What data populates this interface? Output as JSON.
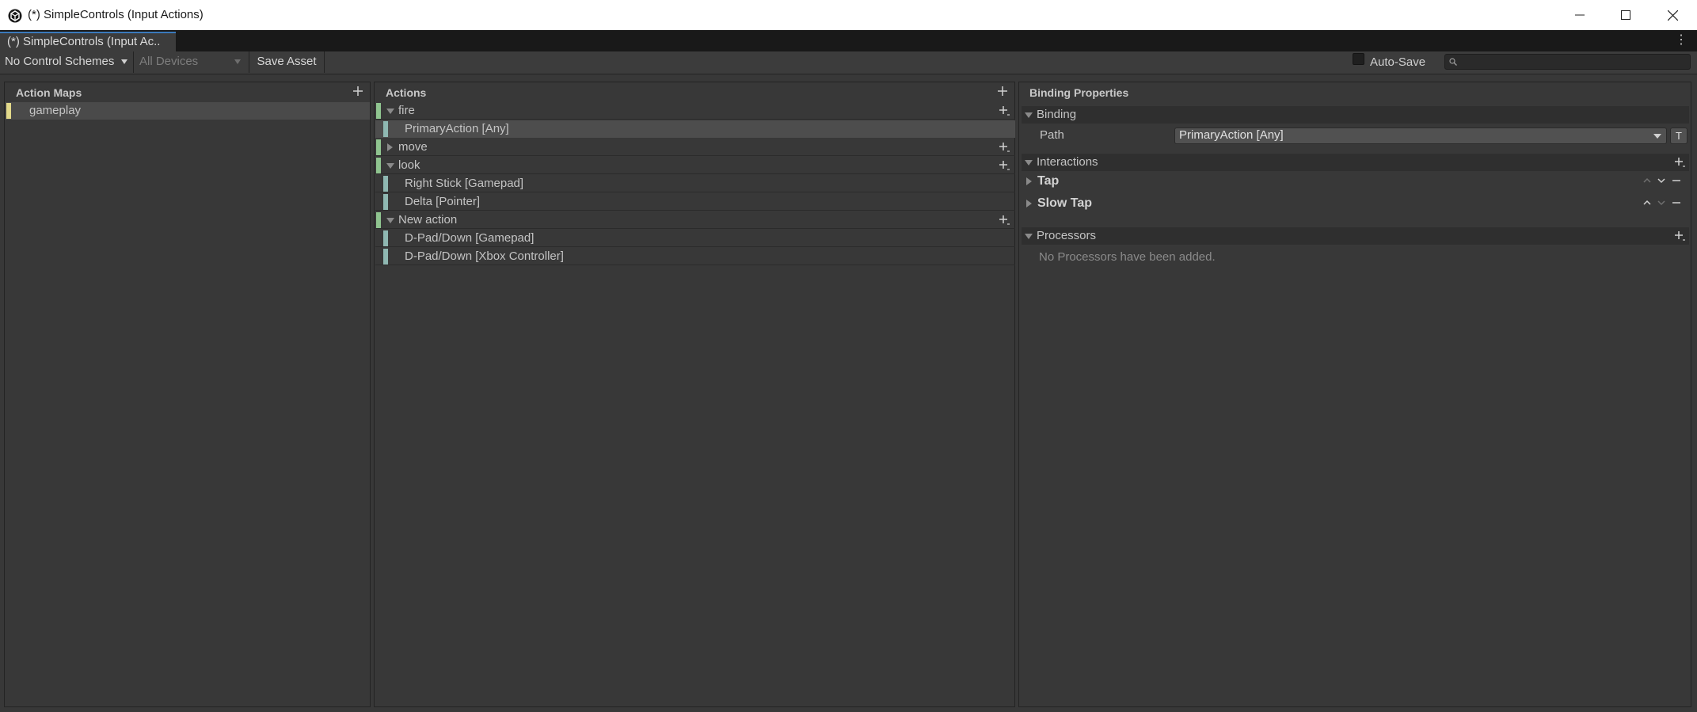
{
  "window": {
    "title": "(*) SimpleControls (Input Actions)",
    "icons": {
      "app": "unity-icon",
      "minimize": "minimize-icon",
      "maximize": "maximize-icon",
      "close": "close-icon"
    }
  },
  "tab": {
    "label": "(*) SimpleControls (Input Ac.."
  },
  "toolbar": {
    "control_schemes": "No Control Schemes",
    "devices": "All Devices",
    "save_asset": "Save Asset",
    "auto_save": "Auto-Save",
    "auto_save_checked": false,
    "search_placeholder": ""
  },
  "action_maps": {
    "header": "Action Maps",
    "items": [
      {
        "label": "gameplay",
        "color": "#e2d98a"
      }
    ]
  },
  "actions": {
    "header": "Actions",
    "items": [
      {
        "label": "fire",
        "expanded": true,
        "bindings": [
          {
            "label": "PrimaryAction [Any]",
            "selected": true
          }
        ]
      },
      {
        "label": "move",
        "expanded": false,
        "bindings": []
      },
      {
        "label": "look",
        "expanded": true,
        "bindings": [
          {
            "label": "Right Stick [Gamepad]"
          },
          {
            "label": "Delta [Pointer]"
          }
        ]
      },
      {
        "label": "New action",
        "expanded": true,
        "bindings": [
          {
            "label": "D-Pad/Down [Gamepad]"
          },
          {
            "label": "D-Pad/Down [Xbox Controller]"
          }
        ]
      }
    ],
    "action_color": "#8fc48f",
    "binding_color": "#8fb8b2"
  },
  "binding_properties": {
    "header": "Binding Properties",
    "binding": {
      "label": "Binding",
      "path_label": "Path",
      "path_value": "PrimaryAction [Any]",
      "t_button": "T"
    },
    "interactions": {
      "label": "Interactions",
      "items": [
        {
          "label": "Tap"
        },
        {
          "label": "Slow Tap"
        }
      ]
    },
    "processors": {
      "label": "Processors",
      "empty_text": "No Processors have been added."
    }
  }
}
